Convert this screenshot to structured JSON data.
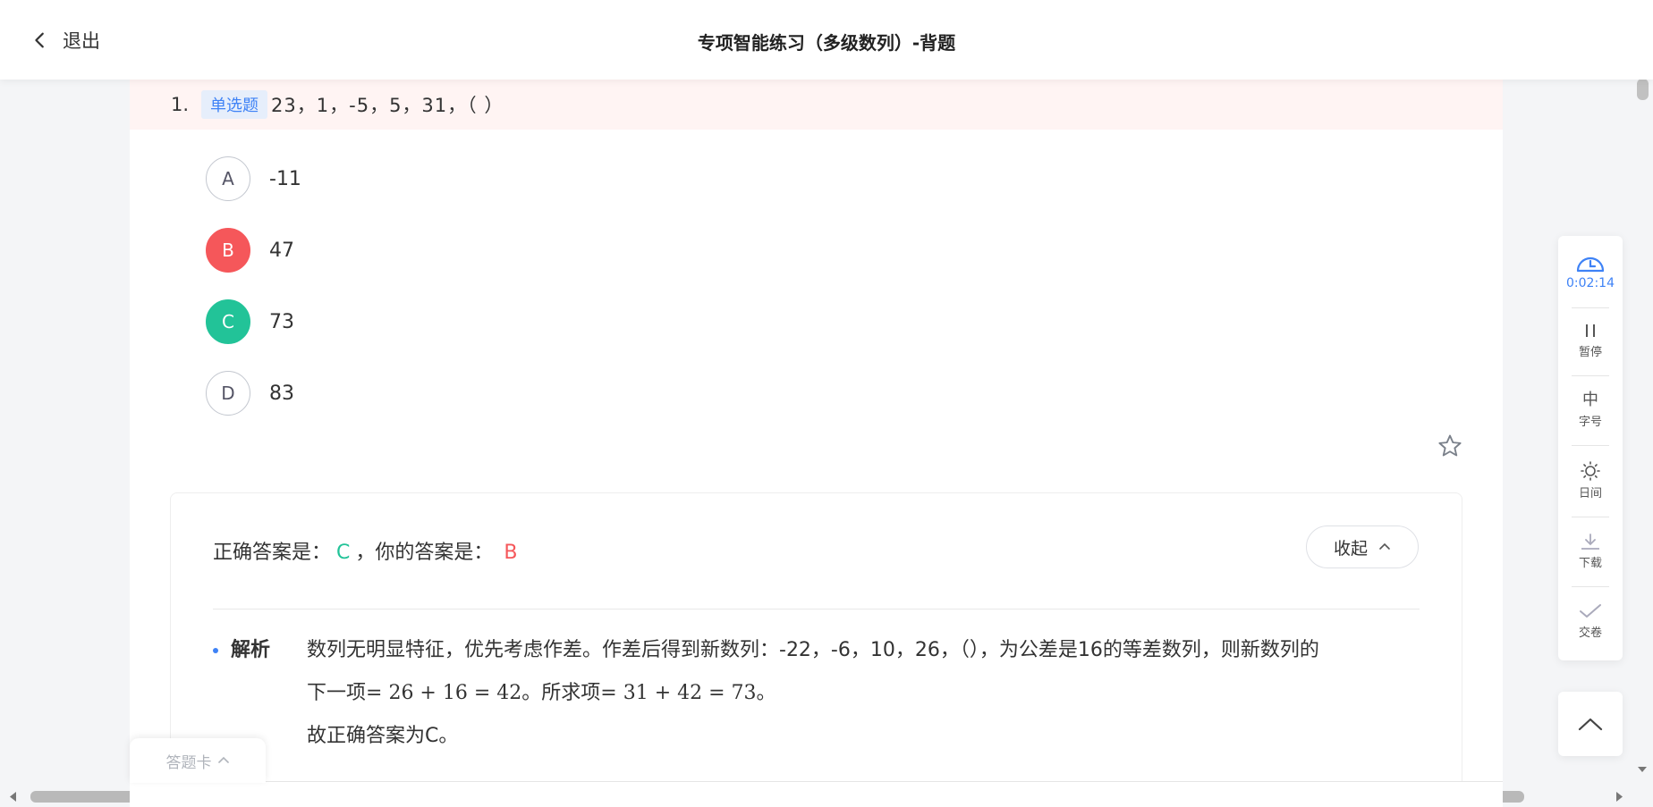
{
  "header": {
    "back_label": "退出",
    "title": "专项智能练习（多级数列）-背题"
  },
  "question": {
    "number": "1.",
    "type_tag": "单选题",
    "stem": "23，1，-5，5，31，（ ）",
    "options": [
      {
        "letter": "A",
        "text": "-11",
        "state": "normal"
      },
      {
        "letter": "B",
        "text": "47",
        "state": "wrong"
      },
      {
        "letter": "C",
        "text": "73",
        "state": "correct"
      },
      {
        "letter": "D",
        "text": "83",
        "state": "normal"
      }
    ]
  },
  "answer": {
    "correct_prefix": "正确答案是：",
    "correct_value": "C",
    "yours_prefix": "，你的答案是：",
    "yours_value": "B",
    "collapse_label": "收起"
  },
  "explanation": {
    "label": "解析",
    "line1": "数列无明显特征，优先考虑作差。作差后得到新数列：-22，-6，10，26，（），为公差是16的等差数列，则新数列的",
    "line2_a": "下一项",
    "line2_math1": "= 26 + 16 = 42",
    "line2_b": "。所求项",
    "line2_math2": "= 31 + 42 = 73",
    "line2_c": "。",
    "line3": "故正确答案为C。"
  },
  "answer_card": {
    "label": "答题卡"
  },
  "sidebar": {
    "timer": "0:02:14",
    "pause": "暂停",
    "font_glyph": "中",
    "font": "字号",
    "day": "日间",
    "download": "下载",
    "submit": "交卷"
  },
  "colors": {
    "accent": "#3e82f6",
    "correct": "#22c398",
    "wrong": "#f5575a"
  }
}
